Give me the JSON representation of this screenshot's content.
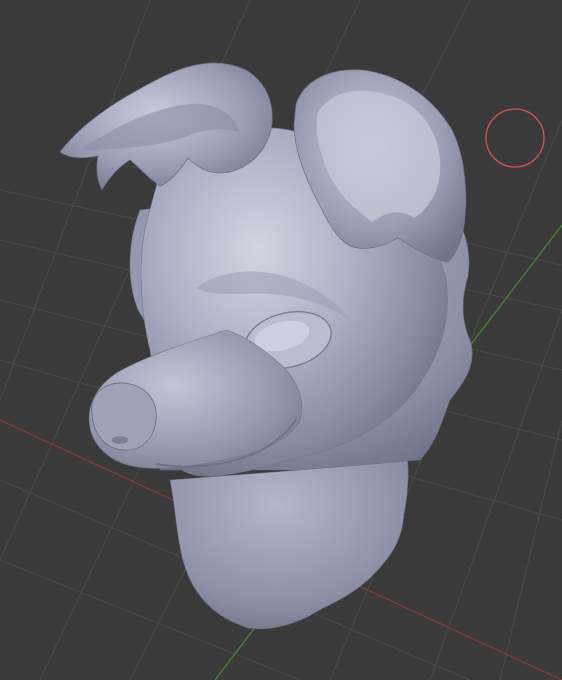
{
  "viewport": {
    "background_color": "#3a3a3a",
    "grid_color": "#4a4a4a",
    "x_axis_color": "#8e3a3a",
    "y_axis_color": "#4f8a2f",
    "cursor_color": "#d65353",
    "model_color": "#a9abc2"
  },
  "scene": {
    "object": "sculpted-dog-head-mesh",
    "view": "perspective",
    "shading": "solid",
    "cursor_icon": "3d-cursor-icon"
  }
}
